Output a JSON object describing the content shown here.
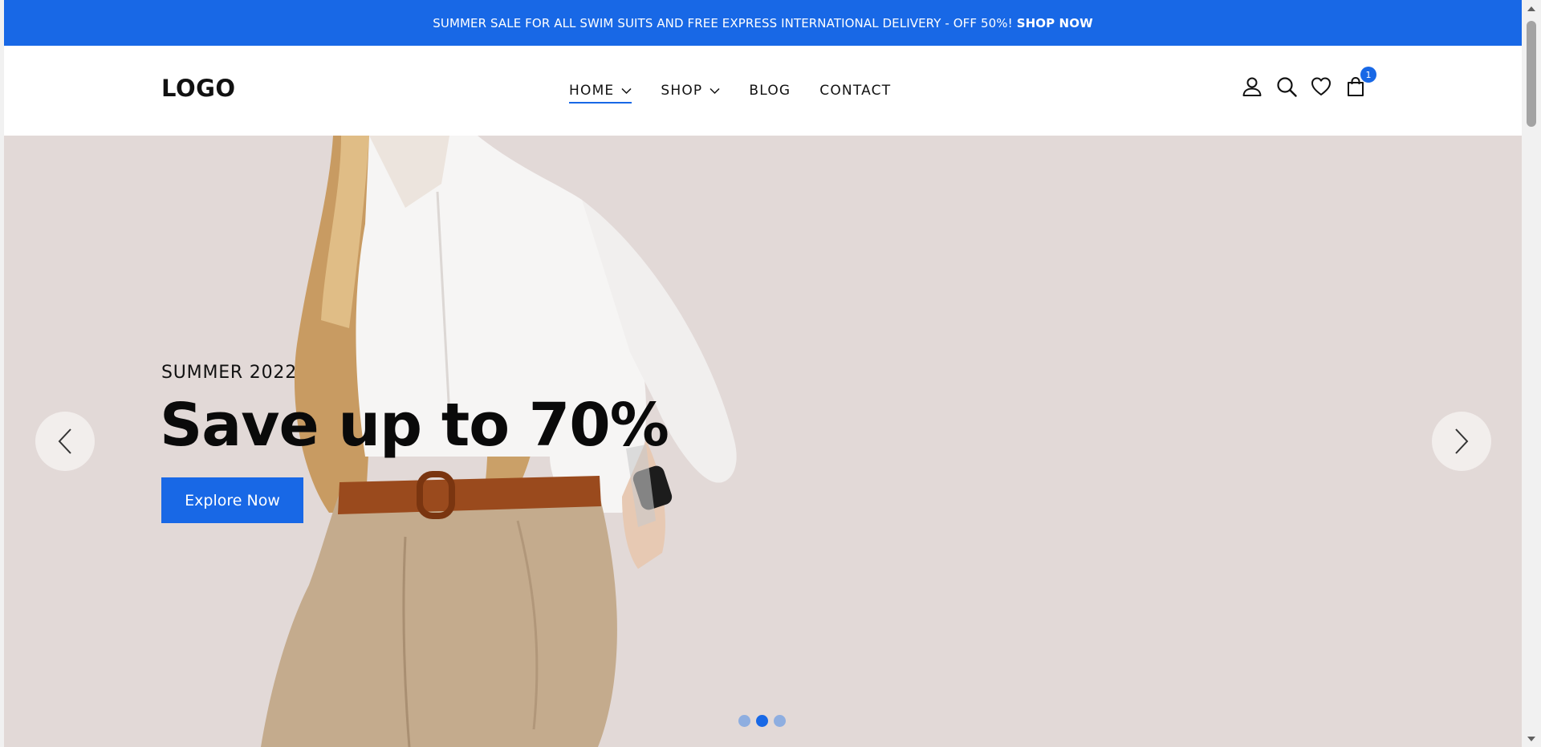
{
  "announcement": {
    "message": "SUMMER SALE FOR ALL SWIM SUITS AND FREE EXPRESS INTERNATIONAL DELIVERY - OFF 50%!",
    "cta": "SHOP NOW"
  },
  "header": {
    "logo": "LOGO",
    "nav": [
      {
        "label": "HOME",
        "has_dropdown": true,
        "active": true
      },
      {
        "label": "SHOP",
        "has_dropdown": true,
        "active": false
      },
      {
        "label": "BLOG",
        "has_dropdown": false,
        "active": false
      },
      {
        "label": "CONTACT",
        "has_dropdown": false,
        "active": false
      }
    ],
    "actions": {
      "account_icon": "user-icon",
      "search_icon": "search-icon",
      "wishlist_icon": "heart-icon",
      "cart_icon": "shopping-bag-icon",
      "cart_count": "1"
    }
  },
  "hero": {
    "eyebrow": "SUMMER 2022",
    "headline": "Save up to 70%",
    "button_label": "Explore Now",
    "prev_icon": "chevron-left-icon",
    "next_icon": "chevron-right-icon",
    "slides_total": 3,
    "active_slide": 2
  },
  "colors": {
    "accent": "#1868e6",
    "hero_bg": "#e2d9d7",
    "dot_inactive": "#8eaee0"
  }
}
